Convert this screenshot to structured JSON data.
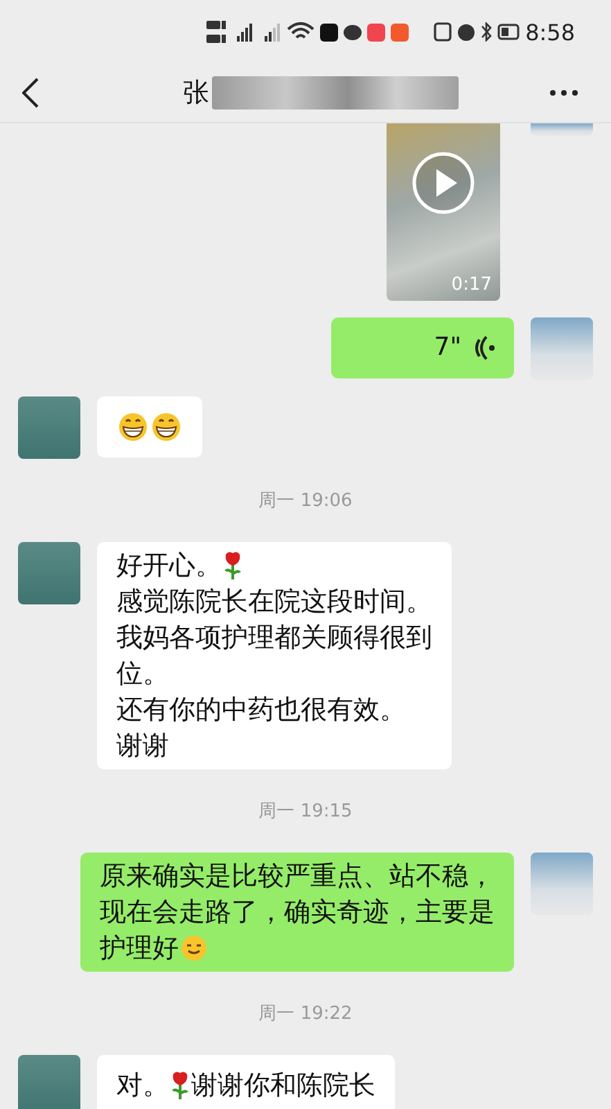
{
  "status_bar": {
    "time": "8:58"
  },
  "header": {
    "title": "张"
  },
  "messages": [
    {
      "kind": "video",
      "outgoing": true,
      "duration": "0:17"
    },
    {
      "kind": "voice",
      "outgoing": true,
      "duration": "7\""
    },
    {
      "kind": "text",
      "outgoing": false,
      "lines": [
        [
          {
            "kind": "grin"
          },
          {
            "kind": "grin"
          }
        ]
      ]
    },
    {
      "kind": "time",
      "text": "周一 19:06"
    },
    {
      "kind": "text",
      "outgoing": false,
      "lines": [
        [
          {
            "kind": "text",
            "text": "好开心。"
          },
          {
            "kind": "rose"
          }
        ],
        [
          {
            "kind": "text",
            "text": "感觉陈院长在院这段时间。"
          }
        ],
        [
          {
            "kind": "text",
            "text": "我妈各项护理都关顾得很到"
          }
        ],
        [
          {
            "kind": "text",
            "text": "位。"
          }
        ],
        [
          {
            "kind": "text",
            "text": "还有你的中药也很有效。"
          }
        ],
        [
          {
            "kind": "text",
            "text": "谢谢"
          }
        ]
      ]
    },
    {
      "kind": "time",
      "text": "周一 19:15"
    },
    {
      "kind": "text",
      "outgoing": true,
      "lines": [
        [
          {
            "kind": "text",
            "text": "原来确实是比较严重点、站不稳，"
          }
        ],
        [
          {
            "kind": "text",
            "text": "现在会走路了，确实奇迹，主要是"
          }
        ],
        [
          {
            "kind": "text",
            "text": "护理好"
          },
          {
            "kind": "smile"
          }
        ]
      ]
    },
    {
      "kind": "time",
      "text": "周一 19:22"
    },
    {
      "kind": "text",
      "outgoing": false,
      "lines": [
        [
          {
            "kind": "text",
            "text": "对。"
          },
          {
            "kind": "rose"
          },
          {
            "kind": "text",
            "text": "谢谢你和陈院长"
          }
        ]
      ]
    }
  ]
}
